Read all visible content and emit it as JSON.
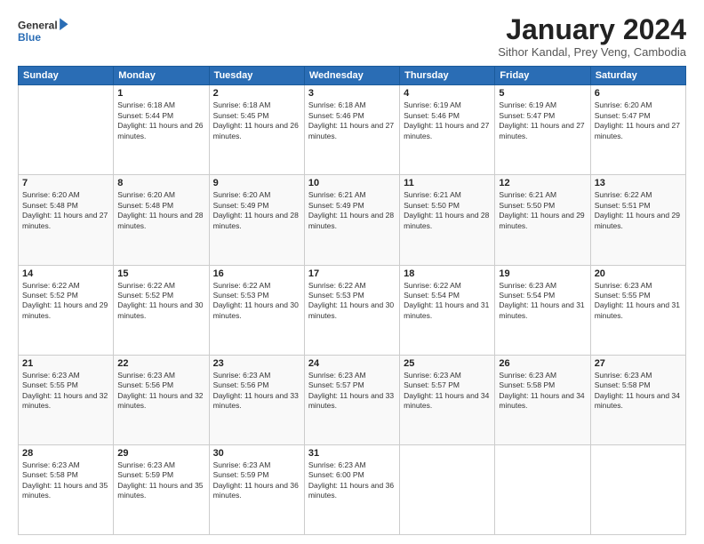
{
  "header": {
    "logo_line1": "General",
    "logo_line2": "Blue",
    "title": "January 2024",
    "subtitle": "Sithor Kandal, Prey Veng, Cambodia"
  },
  "days": [
    "Sunday",
    "Monday",
    "Tuesday",
    "Wednesday",
    "Thursday",
    "Friday",
    "Saturday"
  ],
  "weeks": [
    [
      {
        "day": "",
        "sunrise": "",
        "sunset": "",
        "daylight": ""
      },
      {
        "day": "1",
        "sunrise": "Sunrise: 6:18 AM",
        "sunset": "Sunset: 5:44 PM",
        "daylight": "Daylight: 11 hours and 26 minutes."
      },
      {
        "day": "2",
        "sunrise": "Sunrise: 6:18 AM",
        "sunset": "Sunset: 5:45 PM",
        "daylight": "Daylight: 11 hours and 26 minutes."
      },
      {
        "day": "3",
        "sunrise": "Sunrise: 6:18 AM",
        "sunset": "Sunset: 5:46 PM",
        "daylight": "Daylight: 11 hours and 27 minutes."
      },
      {
        "day": "4",
        "sunrise": "Sunrise: 6:19 AM",
        "sunset": "Sunset: 5:46 PM",
        "daylight": "Daylight: 11 hours and 27 minutes."
      },
      {
        "day": "5",
        "sunrise": "Sunrise: 6:19 AM",
        "sunset": "Sunset: 5:47 PM",
        "daylight": "Daylight: 11 hours and 27 minutes."
      },
      {
        "day": "6",
        "sunrise": "Sunrise: 6:20 AM",
        "sunset": "Sunset: 5:47 PM",
        "daylight": "Daylight: 11 hours and 27 minutes."
      }
    ],
    [
      {
        "day": "7",
        "sunrise": "Sunrise: 6:20 AM",
        "sunset": "Sunset: 5:48 PM",
        "daylight": "Daylight: 11 hours and 27 minutes."
      },
      {
        "day": "8",
        "sunrise": "Sunrise: 6:20 AM",
        "sunset": "Sunset: 5:48 PM",
        "daylight": "Daylight: 11 hours and 28 minutes."
      },
      {
        "day": "9",
        "sunrise": "Sunrise: 6:20 AM",
        "sunset": "Sunset: 5:49 PM",
        "daylight": "Daylight: 11 hours and 28 minutes."
      },
      {
        "day": "10",
        "sunrise": "Sunrise: 6:21 AM",
        "sunset": "Sunset: 5:49 PM",
        "daylight": "Daylight: 11 hours and 28 minutes."
      },
      {
        "day": "11",
        "sunrise": "Sunrise: 6:21 AM",
        "sunset": "Sunset: 5:50 PM",
        "daylight": "Daylight: 11 hours and 28 minutes."
      },
      {
        "day": "12",
        "sunrise": "Sunrise: 6:21 AM",
        "sunset": "Sunset: 5:50 PM",
        "daylight": "Daylight: 11 hours and 29 minutes."
      },
      {
        "day": "13",
        "sunrise": "Sunrise: 6:22 AM",
        "sunset": "Sunset: 5:51 PM",
        "daylight": "Daylight: 11 hours and 29 minutes."
      }
    ],
    [
      {
        "day": "14",
        "sunrise": "Sunrise: 6:22 AM",
        "sunset": "Sunset: 5:52 PM",
        "daylight": "Daylight: 11 hours and 29 minutes."
      },
      {
        "day": "15",
        "sunrise": "Sunrise: 6:22 AM",
        "sunset": "Sunset: 5:52 PM",
        "daylight": "Daylight: 11 hours and 30 minutes."
      },
      {
        "day": "16",
        "sunrise": "Sunrise: 6:22 AM",
        "sunset": "Sunset: 5:53 PM",
        "daylight": "Daylight: 11 hours and 30 minutes."
      },
      {
        "day": "17",
        "sunrise": "Sunrise: 6:22 AM",
        "sunset": "Sunset: 5:53 PM",
        "daylight": "Daylight: 11 hours and 30 minutes."
      },
      {
        "day": "18",
        "sunrise": "Sunrise: 6:22 AM",
        "sunset": "Sunset: 5:54 PM",
        "daylight": "Daylight: 11 hours and 31 minutes."
      },
      {
        "day": "19",
        "sunrise": "Sunrise: 6:23 AM",
        "sunset": "Sunset: 5:54 PM",
        "daylight": "Daylight: 11 hours and 31 minutes."
      },
      {
        "day": "20",
        "sunrise": "Sunrise: 6:23 AM",
        "sunset": "Sunset: 5:55 PM",
        "daylight": "Daylight: 11 hours and 31 minutes."
      }
    ],
    [
      {
        "day": "21",
        "sunrise": "Sunrise: 6:23 AM",
        "sunset": "Sunset: 5:55 PM",
        "daylight": "Daylight: 11 hours and 32 minutes."
      },
      {
        "day": "22",
        "sunrise": "Sunrise: 6:23 AM",
        "sunset": "Sunset: 5:56 PM",
        "daylight": "Daylight: 11 hours and 32 minutes."
      },
      {
        "day": "23",
        "sunrise": "Sunrise: 6:23 AM",
        "sunset": "Sunset: 5:56 PM",
        "daylight": "Daylight: 11 hours and 33 minutes."
      },
      {
        "day": "24",
        "sunrise": "Sunrise: 6:23 AM",
        "sunset": "Sunset: 5:57 PM",
        "daylight": "Daylight: 11 hours and 33 minutes."
      },
      {
        "day": "25",
        "sunrise": "Sunrise: 6:23 AM",
        "sunset": "Sunset: 5:57 PM",
        "daylight": "Daylight: 11 hours and 34 minutes."
      },
      {
        "day": "26",
        "sunrise": "Sunrise: 6:23 AM",
        "sunset": "Sunset: 5:58 PM",
        "daylight": "Daylight: 11 hours and 34 minutes."
      },
      {
        "day": "27",
        "sunrise": "Sunrise: 6:23 AM",
        "sunset": "Sunset: 5:58 PM",
        "daylight": "Daylight: 11 hours and 34 minutes."
      }
    ],
    [
      {
        "day": "28",
        "sunrise": "Sunrise: 6:23 AM",
        "sunset": "Sunset: 5:58 PM",
        "daylight": "Daylight: 11 hours and 35 minutes."
      },
      {
        "day": "29",
        "sunrise": "Sunrise: 6:23 AM",
        "sunset": "Sunset: 5:59 PM",
        "daylight": "Daylight: 11 hours and 35 minutes."
      },
      {
        "day": "30",
        "sunrise": "Sunrise: 6:23 AM",
        "sunset": "Sunset: 5:59 PM",
        "daylight": "Daylight: 11 hours and 36 minutes."
      },
      {
        "day": "31",
        "sunrise": "Sunrise: 6:23 AM",
        "sunset": "Sunset: 6:00 PM",
        "daylight": "Daylight: 11 hours and 36 minutes."
      },
      {
        "day": "",
        "sunrise": "",
        "sunset": "",
        "daylight": ""
      },
      {
        "day": "",
        "sunrise": "",
        "sunset": "",
        "daylight": ""
      },
      {
        "day": "",
        "sunrise": "",
        "sunset": "",
        "daylight": ""
      }
    ]
  ]
}
